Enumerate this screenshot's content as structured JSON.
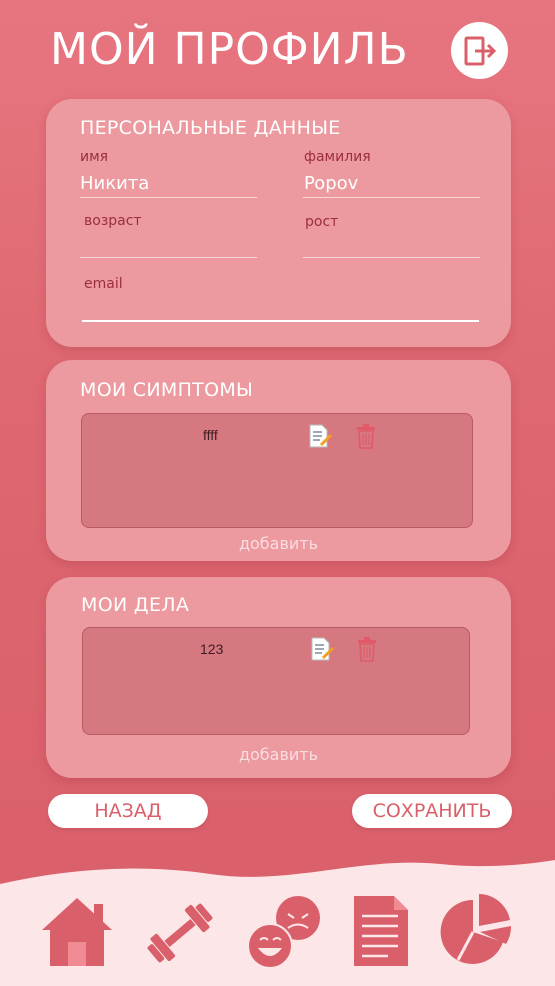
{
  "header": {
    "title": "МОЙ ПРОФИЛЬ",
    "logout_icon": "logout-icon"
  },
  "personal": {
    "title": "ПЕРСОНАЛЬНЫЕ ДАННЫЕ",
    "first_name": {
      "label": "имя",
      "value": "Никита"
    },
    "last_name": {
      "label": "фамилия",
      "value": "Popov"
    },
    "age": {
      "label": "возраст",
      "value": ""
    },
    "height": {
      "label": "рост",
      "value": ""
    },
    "email": {
      "label": "email",
      "value": ""
    }
  },
  "symptoms": {
    "title": "МОИ СИМПТОМЫ",
    "items": [
      {
        "text": "ffff"
      }
    ],
    "add_label": "добавить"
  },
  "tasks": {
    "title": "МОИ ДЕЛА",
    "items": [
      {
        "text": "123"
      }
    ],
    "add_label": "добавить"
  },
  "actions": {
    "back_label": "НАЗАД",
    "save_label": "СОХРАНИТЬ"
  },
  "nav": {
    "items": [
      {
        "name": "home",
        "icon": "home-icon"
      },
      {
        "name": "workout",
        "icon": "dumbbell-icon"
      },
      {
        "name": "mood",
        "icon": "mood-faces-icon"
      },
      {
        "name": "notes",
        "icon": "document-icon"
      },
      {
        "name": "stats",
        "icon": "pie-chart-icon"
      }
    ]
  },
  "colors": {
    "background": "#df6a74",
    "card": "#ec9a9f",
    "nav_background": "#fde6e7",
    "icon_accent": "#d9606b"
  }
}
